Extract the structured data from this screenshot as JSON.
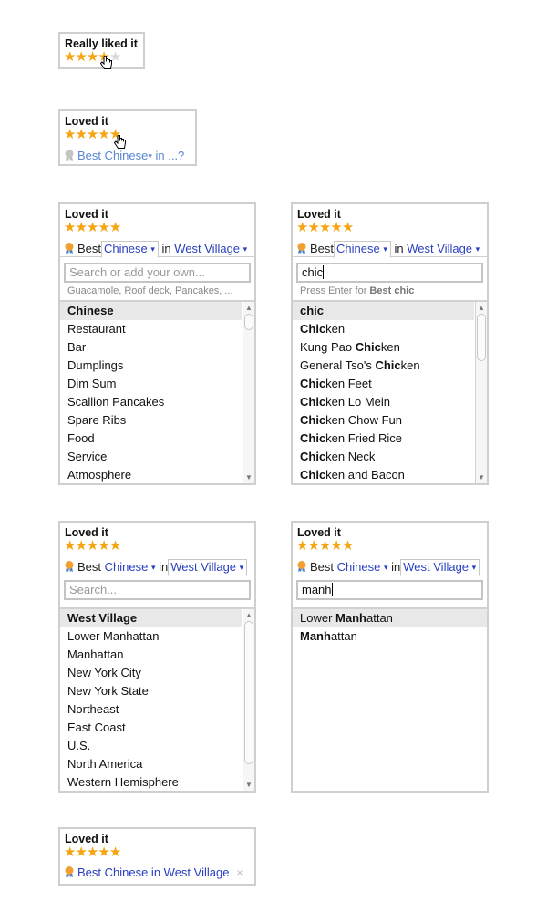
{
  "colors": {
    "star_on": "#f5a511",
    "star_off": "#d8d8d8",
    "link": "#2a3fbf",
    "link_light": "#5a86d6",
    "selected_row": "#e8e8e8",
    "border": "#cfcfcf"
  },
  "icons": {
    "star": "★",
    "medal": "medal-icon",
    "hand_cursor": "hand-pointer-icon",
    "dropdown": "▾",
    "scroll_up": "▲",
    "scroll_down": "▼",
    "clear": "×"
  },
  "panel1": {
    "title": "Really liked it",
    "rating": 4,
    "max": 5
  },
  "panel2": {
    "title": "Loved it",
    "rating": 5,
    "max": 5,
    "best": "Best Chinese",
    "in": "in ...?"
  },
  "panel3": {
    "title": "Loved it",
    "rating": 5,
    "best": "Best",
    "category": "Chinese",
    "in": "in",
    "location": "West Village",
    "search_placeholder": "Search or add your own...",
    "hint": "Guacamole, Roof deck, Pancakes, ...",
    "items": [
      "Chinese",
      "Restaurant",
      "Bar",
      "Dumplings",
      "Dim Sum",
      "Scallion Pancakes",
      "Spare Ribs",
      "Food",
      "Service",
      "Atmosphere"
    ]
  },
  "panel4": {
    "title": "Loved it",
    "rating": 5,
    "best": "Best",
    "category": "Chinese",
    "in": "in",
    "location": "West Village",
    "search_value": "chic",
    "hint_prefix": "Press Enter for ",
    "hint_bold": "Best chic",
    "items": [
      {
        "match": "chic",
        "rest": "",
        "pre": ""
      },
      {
        "pre": "",
        "match": "Chic",
        "rest": "ken"
      },
      {
        "pre": "Kung Pao ",
        "match": "Chic",
        "rest": "ken"
      },
      {
        "pre": "General Tso's ",
        "match": "Chic",
        "rest": "ken"
      },
      {
        "pre": "",
        "match": "Chic",
        "rest": "ken Feet"
      },
      {
        "pre": "",
        "match": "Chic",
        "rest": "ken Lo Mein"
      },
      {
        "pre": "",
        "match": "Chic",
        "rest": "ken Chow Fun"
      },
      {
        "pre": "",
        "match": "Chic",
        "rest": "ken Fried Rice"
      },
      {
        "pre": "",
        "match": "Chic",
        "rest": "ken Neck"
      },
      {
        "pre": "",
        "match": "Chic",
        "rest": "ken and Bacon"
      }
    ]
  },
  "panel5": {
    "title": "Loved it",
    "rating": 5,
    "best": "Best",
    "category": "Chinese",
    "in": "in",
    "location": "West Village",
    "search_placeholder": "Search...",
    "items": [
      "West Village",
      "Lower Manhattan",
      "Manhattan",
      "New York City",
      "New York State",
      "Northeast",
      "East Coast",
      "U.S.",
      "North America",
      "Western Hemisphere"
    ]
  },
  "panel6": {
    "title": "Loved it",
    "rating": 5,
    "best": "Best",
    "category": "Chinese",
    "in": "in",
    "location": "West Village",
    "search_value": "manh",
    "items": [
      {
        "pre": "Lower ",
        "match": "Manh",
        "rest": "attan"
      },
      {
        "pre": "",
        "match": "Manh",
        "rest": "attan"
      }
    ]
  },
  "panel7": {
    "title": "Loved it",
    "rating": 5,
    "label": "Best Chinese in West Village",
    "clear": "×"
  }
}
